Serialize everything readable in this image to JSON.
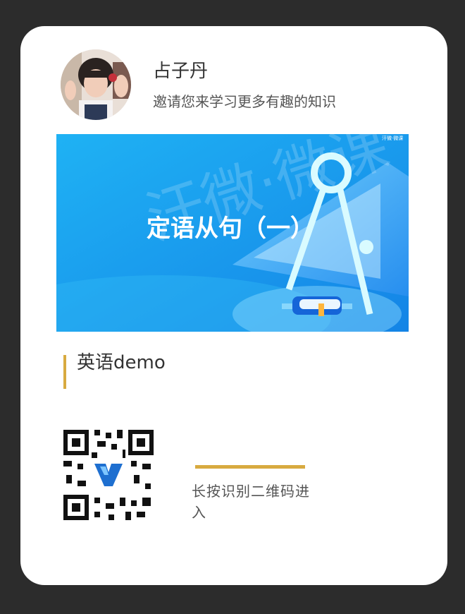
{
  "profile": {
    "name": "占子丹",
    "invite": "邀请您来学习更多有趣的知识"
  },
  "banner": {
    "title": "定语从句（一）",
    "watermark": "汗微·微课",
    "corner_label": "汗微·微课"
  },
  "course": {
    "title": "英语demo"
  },
  "qr": {
    "hint": "长按识别二维码进入"
  },
  "colors": {
    "background": "#2c2c2c",
    "card": "#ffffff",
    "accent_gold": "#d8aa40",
    "banner_blue": "#1aa3f0"
  },
  "icons": {
    "avatar": "child-photo-avatar",
    "qr": "qr-code-icon",
    "compass": "compass-icon",
    "book": "book-icon"
  }
}
